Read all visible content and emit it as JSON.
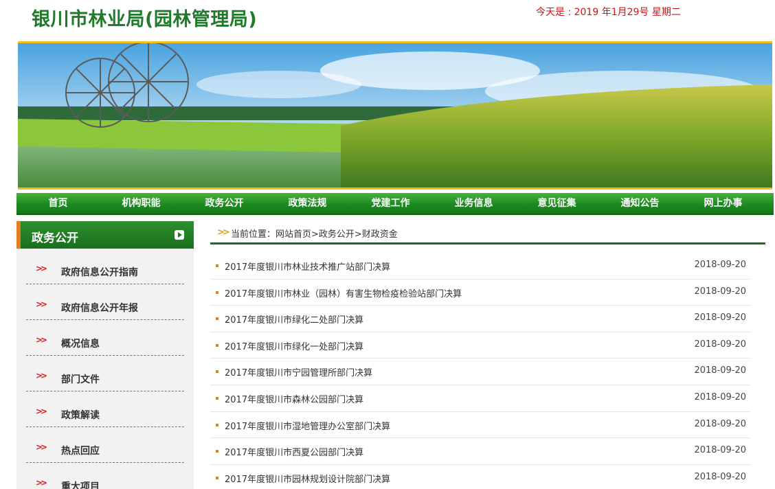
{
  "header": {
    "site_title": "银川市林业局(园林管理局)",
    "today": "今天是 : 2019 年1月29号 星期二"
  },
  "nav": [
    {
      "label": "首页"
    },
    {
      "label": "机构职能"
    },
    {
      "label": "政务公开"
    },
    {
      "label": "政策法规"
    },
    {
      "label": "党建工作"
    },
    {
      "label": "业务信息"
    },
    {
      "label": "意见征集"
    },
    {
      "label": "通知公告"
    },
    {
      "label": "网上办事"
    }
  ],
  "sidebar": {
    "title": "政务公开",
    "items": [
      {
        "label": "政府信息公开指南"
      },
      {
        "label": "政府信息公开年报"
      },
      {
        "label": "概况信息"
      },
      {
        "label": "部门文件"
      },
      {
        "label": "政策解读"
      },
      {
        "label": "热点回应"
      },
      {
        "label": "重大项目"
      }
    ]
  },
  "breadcrumb": {
    "text": "当前位置：网站首页>政务公开>财政资金"
  },
  "articles": [
    {
      "title": "2017年度银川市林业技术推广站部门决算",
      "date": "2018-09-20"
    },
    {
      "title": "2017年度银川市林业（园林）有害生物检疫检验站部门决算",
      "date": "2018-09-20"
    },
    {
      "title": "2017年度银川市绿化二处部门决算",
      "date": "2018-09-20"
    },
    {
      "title": "2017年度银川市绿化一处部门决算",
      "date": "2018-09-20"
    },
    {
      "title": "2017年度银川市宁园管理所部门决算",
      "date": "2018-09-20"
    },
    {
      "title": "2017年度银川市森林公园部门决算",
      "date": "2018-09-20"
    },
    {
      "title": "2017年度银川市湿地管理办公室部门决算",
      "date": "2018-09-20"
    },
    {
      "title": "2017年度银川市西夏公园部门决算",
      "date": "2018-09-20"
    },
    {
      "title": "2017年度银川市园林规划设计院部门决算",
      "date": "2018-09-20"
    }
  ],
  "colors": {
    "brand_green": "#1f7a2a",
    "date_red": "#c8141a",
    "accent_orange": "#e07f1c"
  }
}
